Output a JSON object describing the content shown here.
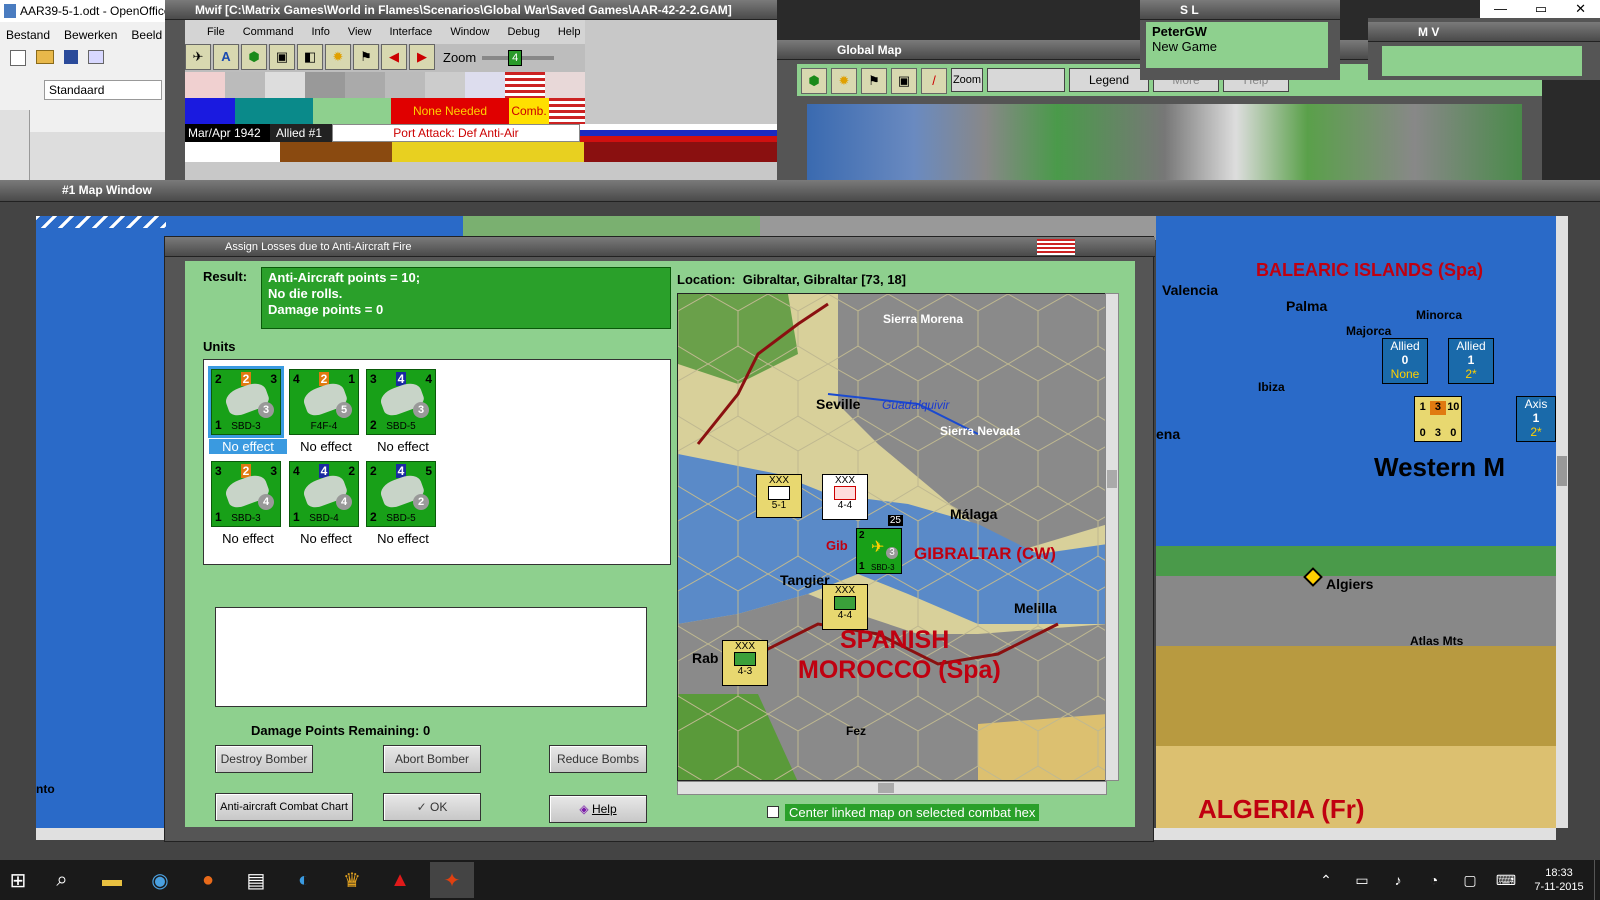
{
  "openoffice": {
    "title": "AAR39-5-1.odt - OpenOffice",
    "menu": [
      "Bestand",
      "Bewerken",
      "Beeld"
    ],
    "style_box": "Standaard"
  },
  "mwif": {
    "title": "Mwif [C:\\Matrix Games\\World in Flames\\Scenarios\\Global War\\Saved Games\\AAR-42-2-2.GAM]",
    "menu": [
      "File",
      "Command",
      "Info",
      "View",
      "Interface",
      "Window",
      "Debug",
      "Help"
    ],
    "zoom_label": "Zoom",
    "zoom_value": "4",
    "none_needed": "None Needed",
    "comb": "Comb.",
    "date": "Mar/Apr 1942",
    "allied": "Allied #1",
    "phase": "Port Attack: Def Anti-Air"
  },
  "global_map": {
    "title": "Global Map",
    "zoom": "Zoom",
    "legend": "Legend",
    "more": "More",
    "help": "Help"
  },
  "sl_window": {
    "title": "S L",
    "line1": "PeterGW",
    "line2": "New Game"
  },
  "mv_window": {
    "title": "M V"
  },
  "map_window": {
    "title": "#1 Map Window"
  },
  "dialog": {
    "title": "Assign Losses due to Anti-Aircraft Fire",
    "result_label": "Result:",
    "result_lines": [
      "Anti-Aircraft points = 10;",
      "No die rolls.",
      "Damage points = 0"
    ],
    "units_label": "Units",
    "units": [
      {
        "tl": "2",
        "tm": "2",
        "tr": "3",
        "circle": "3",
        "bl": "1",
        "name": "SBD-3",
        "status": "No effect",
        "selected": true,
        "tmcolor": "#e07a10"
      },
      {
        "tl": "4",
        "tm": "2",
        "tr": "1",
        "circle": "5",
        "bl": "",
        "name": "F4F-4",
        "status": "No effect",
        "selected": false,
        "tmcolor": "#e07a10"
      },
      {
        "tl": "3",
        "tm": "4",
        "tr": "4",
        "circle": "3",
        "bl": "2",
        "name": "SBD-5",
        "status": "No effect",
        "selected": false,
        "tmcolor": "#1a2aa0"
      },
      {
        "tl": "3",
        "tm": "2",
        "tr": "3",
        "circle": "4",
        "bl": "1",
        "name": "SBD-3",
        "status": "No effect",
        "selected": false,
        "tmcolor": "#e07a10"
      },
      {
        "tl": "4",
        "tm": "4",
        "tr": "2",
        "circle": "4",
        "bl": "1",
        "name": "SBD-4",
        "status": "No effect",
        "selected": false,
        "tmcolor": "#1a2aa0"
      },
      {
        "tl": "2",
        "tm": "4",
        "tr": "5",
        "circle": "2",
        "bl": "2",
        "name": "SBD-5",
        "status": "No effect",
        "selected": false,
        "tmcolor": "#1a2aa0"
      }
    ],
    "damage_remaining_label": "Damage Points Remaining:",
    "damage_remaining_value": "0",
    "buttons": {
      "destroy": "Destroy Bomber",
      "abort": "Abort Bomber",
      "reduce": "Reduce Bombs",
      "chart": "Anti-aircraft Combat Chart",
      "ok": "OK",
      "help": "Help"
    },
    "location": "Location:  Gibraltar, Gibraltar [73, 18]",
    "center_linked": "Center linked map on selected combat hex",
    "minimap_labels": {
      "sierra_morena": "Sierra Morena",
      "seville": "Seville",
      "guadalquivir": "Guadalquivir",
      "sierra_nevada": "Sierra Nevada",
      "malaga": "Málaga",
      "gibraltar": "GIBRALTAR (CW)",
      "gib": "Gib",
      "tangier": "Tangier",
      "melilla": "Melilla",
      "spanish_morocco_1": "SPANISH",
      "spanish_morocco_2": "MOROCCO (Spa)",
      "rab": "Rab",
      "fez": "Fez"
    },
    "minimap_units": [
      {
        "top": "XXX",
        "val": "5-1",
        "side": "XV Spa"
      },
      {
        "top": "XXX",
        "val": "4-4",
        "side": "Spa"
      },
      {
        "top": "XXX",
        "val": "4-4",
        "side": "Spa"
      },
      {
        "top": "XXX",
        "val": "4-3",
        "side": "R"
      }
    ],
    "gib_counter": {
      "tl": "2",
      "circle": "3",
      "bl": "1",
      "name": "SBD-3",
      "stack": "25"
    }
  },
  "bigmap": {
    "balearic": "BALEARIC ISLANDS (Spa)",
    "valencia": "Valencia",
    "palma": "Palma",
    "majorca": "Majorca",
    "minorca": "Minorca",
    "ibiza": "Ibiza",
    "western": "Western M",
    "algiers": "Algiers",
    "atlas": "Atlas Mts",
    "algeria": "ALGERIA (Fr)",
    "ena": "ena",
    "nto": "nto",
    "allied_a": {
      "title": "Allied",
      "num": "0",
      "sub": "None"
    },
    "allied_b": {
      "title": "Allied",
      "num": "1",
      "sub": "2*"
    },
    "axis": {
      "title": "Axis",
      "num": "1",
      "sub": "2*"
    },
    "stack": {
      "a": "1",
      "b": "3",
      "c": "10",
      "d": "0",
      "e": "3",
      "f": "0"
    }
  },
  "taskbar": {
    "time": "18:33",
    "date": "7-11-2015"
  }
}
